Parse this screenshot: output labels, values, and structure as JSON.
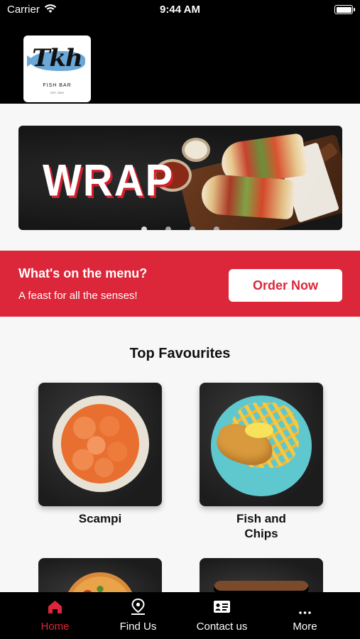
{
  "status_bar": {
    "carrier": "Carrier",
    "time": "9:44 AM"
  },
  "header": {
    "logo": {
      "mark": "Tkh",
      "subtitle": "FISH BAR",
      "est": "EST. 2000"
    }
  },
  "banner": {
    "headline": "WRAP",
    "slides_total": 4,
    "active_slide": 1
  },
  "promo": {
    "title": "What's on the menu?",
    "subtitle": "A feast for all the senses!",
    "button_label": "Order Now",
    "background_color": "#dc2639"
  },
  "favourites": {
    "title": "Top Favourites",
    "items": [
      {
        "label": "Scampi"
      },
      {
        "label": "Fish and Chips"
      }
    ]
  },
  "tab_bar": {
    "active_color": "#dc2639",
    "tabs": [
      {
        "label": "Home",
        "icon": "home-icon",
        "active": true
      },
      {
        "label": "Find Us",
        "icon": "map-pin-icon",
        "active": false
      },
      {
        "label": "Contact us",
        "icon": "contact-card-icon",
        "active": false
      },
      {
        "label": "More",
        "icon": "more-dots-icon",
        "active": false
      }
    ]
  }
}
